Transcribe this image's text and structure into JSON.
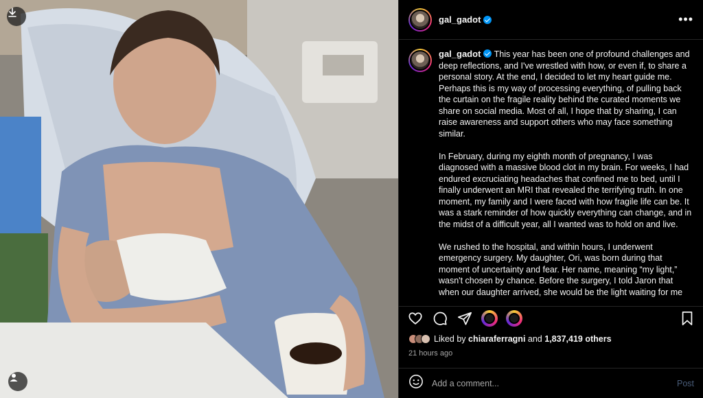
{
  "post": {
    "username": "gal_gadot",
    "verified": true,
    "paragraphs": [
      "This year has been one of profound challenges and deep reflections, and I've wrestled with how, or even if, to share a personal story. At the end, I decided to let my heart guide me. Perhaps this is my way of processing everything, of pulling back the curtain on the fragile reality behind the curated moments we share on social media. Most of all, I hope that by sharing, I can raise awareness and support others who may face something similar.",
      "In February, during my eighth month of pregnancy, I was diagnosed with a massive blood clot in my brain. For weeks, I had endured excruciating headaches that confined me to bed, until I finally underwent an MRI that revealed the terrifying truth. In one moment, my family and I were faced with how fragile life can be. It was a stark reminder of how quickly everything can change, and in the midst of a difficult year, all I wanted was to hold on and live.",
      "We rushed to the hospital, and within hours, I underwent emergency surgery. My daughter, Ori, was born during that moment of uncertainty and fear. Her name, meaning “my light,” wasn't chosen by chance. Before the surgery, I told Jaron that when our daughter arrived, she would be the light waiting for me"
    ],
    "liked_by_prefix": "Liked by",
    "liked_by_user": "chiaraferragni",
    "liked_by_and": "and",
    "likes_count": "1,837,419 others",
    "time_ago": "21 hours ago"
  },
  "comment": {
    "placeholder": "Add a comment...",
    "post_label": "Post"
  },
  "icons": {
    "top_left": "download-icon",
    "bottom_left": "user-tag-icon",
    "more": "more-options-icon",
    "like": "heart-icon",
    "comment": "comment-icon",
    "share": "share-icon",
    "save": "bookmark-icon",
    "emoji": "emoji-icon"
  },
  "colors": {
    "verified": "#0095f6",
    "background": "#000000",
    "muted_text": "#a8a8a8"
  }
}
